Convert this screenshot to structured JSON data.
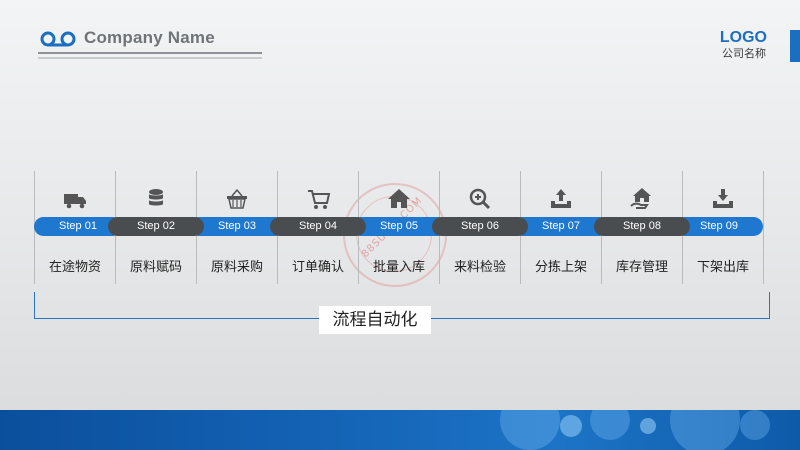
{
  "header": {
    "company_name": "Company Name",
    "logo_text": "LOGO",
    "logo_subtitle": "公司名称"
  },
  "colors": {
    "accent_blue": "#1f78cf",
    "dark_pill": "#4a4d50"
  },
  "steps": [
    {
      "step": "Step 01",
      "label": "在途物资",
      "icon": "truck-icon",
      "pill": "blue"
    },
    {
      "step": "Step 02",
      "label": "原料赋码",
      "icon": "database-icon",
      "pill": "dark"
    },
    {
      "step": "Step 03",
      "label": "原料采购",
      "icon": "basket-icon",
      "pill": "blue"
    },
    {
      "step": "Step 04",
      "label": "订单确认",
      "icon": "cart-icon",
      "pill": "dark"
    },
    {
      "step": "Step 05",
      "label": "批量入库",
      "icon": "home-icon",
      "pill": "blue"
    },
    {
      "step": "Step 06",
      "label": "来料检验",
      "icon": "zoom-in-icon",
      "pill": "dark"
    },
    {
      "step": "Step 07",
      "label": "分拣上架",
      "icon": "upload-tray-icon",
      "pill": "blue"
    },
    {
      "step": "Step 08",
      "label": "库存管理",
      "icon": "house-hand-icon",
      "pill": "dark"
    },
    {
      "step": "Step 09",
      "label": "下架出库",
      "icon": "download-tray-icon",
      "pill": "blue"
    }
  ],
  "summary_label": "流程自动化",
  "watermark_text": "88SUCAI.COM"
}
